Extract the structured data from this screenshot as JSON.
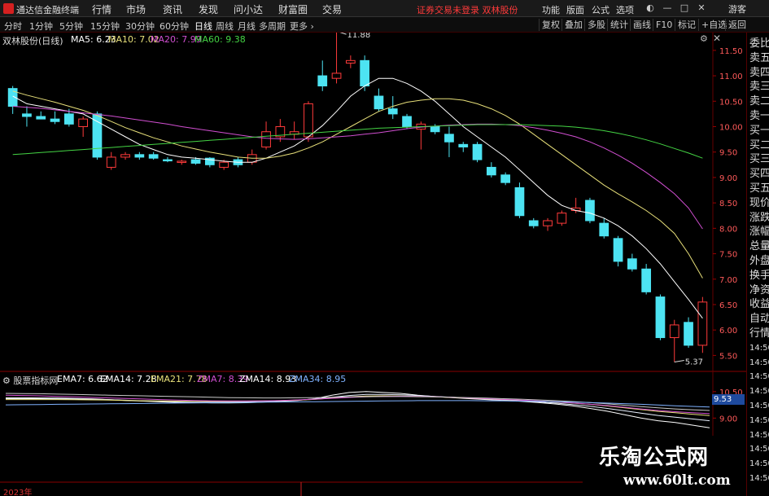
{
  "app": {
    "title": "通达信金融终端"
  },
  "menu": [
    "行情",
    "市场",
    "资讯",
    "发现",
    "问小达",
    "财富圈",
    "交易"
  ],
  "status": "证券交易未登录  双林股份",
  "topright": [
    "功能",
    "版面",
    "公式",
    "选项"
  ],
  "login": "游客",
  "periods": [
    "分时",
    "1分钟",
    "5分钟",
    "15分钟",
    "30分钟",
    "60分钟",
    "日线",
    "周线",
    "月线",
    "多周期",
    "更多"
  ],
  "periods_active": "日线",
  "toolbar_right": [
    "复权",
    "叠加",
    "多股",
    "统计",
    "画线",
    "F10",
    "标记",
    "+自选",
    "返回"
  ],
  "stock_label": "双林股份(日线)",
  "ma": {
    "ma5": {
      "label": "MA5: 6.23",
      "color": "#ffffff"
    },
    "ma10": {
      "label": "MA10: 7.02",
      "color": "#e8e07a"
    },
    "ma20": {
      "label": "MA20: 7.99",
      "color": "#d14fd1"
    },
    "ma60": {
      "label": "MA60: 9.38",
      "color": "#44d444"
    }
  },
  "high_annotation": "11.88",
  "low_annotation": "5.37",
  "right_panel": [
    "委比",
    "卖五",
    "卖四",
    "卖三",
    "卖二",
    "卖一",
    "买一",
    "买二",
    "买三",
    "买四",
    "买五",
    "现价",
    "涨跌",
    "涨幅",
    "总量",
    "外盘",
    "换手",
    "净资",
    "收益",
    "自动",
    "行情",
    "14:50",
    "14:50",
    "14:50",
    "14:50",
    "14:50",
    "14:50",
    "14:50",
    "14:50",
    "14:50",
    "14:50"
  ],
  "indicator": {
    "label": "股票指标网",
    "ema7": {
      "label": "EMA7: 6.62",
      "color": "#ffffff"
    },
    "ema14": {
      "label": "EMA14: 7.28",
      "color": "#ffffff"
    },
    "ema21": {
      "label": "EMA21: 7.78",
      "color": "#e8e07a"
    },
    "zma7": {
      "label": "ZMA7: 8.39",
      "color": "#d14fd1"
    },
    "zma14": {
      "label": "ZMA14: 8.93",
      "color": "#ffffff"
    },
    "zma34": {
      "label": "ZMA34: 8.95",
      "color": "#7fb2ff"
    },
    "tag": "9.53",
    "axis": [
      "10.50",
      "9.00"
    ]
  },
  "year_label": "2023年",
  "watermark": {
    "title": "乐淘公式网",
    "url": "www.60lt.com"
  },
  "chart_data": {
    "type": "candlestick",
    "ylim": [
      5.25,
      11.85
    ],
    "yticks": [
      "11.50",
      "11.00",
      "10.50",
      "10.00",
      "9.50",
      "9.00",
      "8.50",
      "8.00",
      "7.50",
      "7.00",
      "6.50",
      "6.00",
      "5.50"
    ],
    "colors": {
      "up": "#ff3b3b",
      "down": "#4de3f2"
    },
    "candles": [
      {
        "o": 10.75,
        "h": 10.8,
        "l": 10.25,
        "c": 10.4
      },
      {
        "o": 10.25,
        "h": 10.4,
        "l": 10.0,
        "c": 10.2
      },
      {
        "o": 10.2,
        "h": 10.3,
        "l": 10.15,
        "c": 10.15
      },
      {
        "o": 10.15,
        "h": 10.3,
        "l": 10.05,
        "c": 10.1
      },
      {
        "o": 10.25,
        "h": 10.35,
        "l": 10.0,
        "c": 10.05
      },
      {
        "o": 10.0,
        "h": 10.2,
        "l": 9.8,
        "c": 10.15
      },
      {
        "o": 10.25,
        "h": 10.3,
        "l": 9.35,
        "c": 9.4
      },
      {
        "o": 9.2,
        "h": 9.5,
        "l": 9.15,
        "c": 9.4
      },
      {
        "o": 9.4,
        "h": 9.5,
        "l": 9.35,
        "c": 9.45
      },
      {
        "o": 9.45,
        "h": 9.5,
        "l": 9.35,
        "c": 9.4
      },
      {
        "o": 9.45,
        "h": 9.5,
        "l": 9.35,
        "c": 9.38
      },
      {
        "o": 9.35,
        "h": 9.4,
        "l": 9.3,
        "c": 9.33
      },
      {
        "o": 9.3,
        "h": 9.35,
        "l": 9.25,
        "c": 9.32
      },
      {
        "o": 9.35,
        "h": 9.4,
        "l": 9.25,
        "c": 9.28
      },
      {
        "o": 9.38,
        "h": 9.4,
        "l": 9.2,
        "c": 9.25
      },
      {
        "o": 9.2,
        "h": 9.35,
        "l": 9.15,
        "c": 9.3
      },
      {
        "o": 9.35,
        "h": 9.4,
        "l": 9.2,
        "c": 9.25
      },
      {
        "o": 9.3,
        "h": 9.55,
        "l": 9.25,
        "c": 9.45
      },
      {
        "o": 9.6,
        "h": 10.1,
        "l": 9.55,
        "c": 9.9
      },
      {
        "o": 9.8,
        "h": 10.15,
        "l": 9.7,
        "c": 10.0
      },
      {
        "o": 9.85,
        "h": 10.1,
        "l": 9.75,
        "c": 9.9
      },
      {
        "o": 9.8,
        "h": 10.5,
        "l": 9.7,
        "c": 10.45
      },
      {
        "o": 11.0,
        "h": 11.3,
        "l": 10.7,
        "c": 10.8
      },
      {
        "o": 10.95,
        "h": 11.88,
        "l": 10.85,
        "c": 11.05
      },
      {
        "o": 11.25,
        "h": 11.4,
        "l": 11.15,
        "c": 11.3
      },
      {
        "o": 11.3,
        "h": 11.4,
        "l": 10.7,
        "c": 10.8
      },
      {
        "o": 10.6,
        "h": 10.75,
        "l": 10.3,
        "c": 10.35
      },
      {
        "o": 10.35,
        "h": 10.6,
        "l": 10.15,
        "c": 10.25
      },
      {
        "o": 10.2,
        "h": 10.25,
        "l": 9.95,
        "c": 10.0
      },
      {
        "o": 9.95,
        "h": 10.1,
        "l": 9.55,
        "c": 10.05
      },
      {
        "o": 10.0,
        "h": 10.05,
        "l": 9.85,
        "c": 9.9
      },
      {
        "o": 9.85,
        "h": 10.0,
        "l": 9.4,
        "c": 9.7
      },
      {
        "o": 9.65,
        "h": 9.7,
        "l": 9.5,
        "c": 9.6
      },
      {
        "o": 9.65,
        "h": 9.7,
        "l": 9.3,
        "c": 9.35
      },
      {
        "o": 9.2,
        "h": 9.3,
        "l": 9.0,
        "c": 9.05
      },
      {
        "o": 9.05,
        "h": 9.1,
        "l": 8.85,
        "c": 8.9
      },
      {
        "o": 8.8,
        "h": 8.9,
        "l": 8.2,
        "c": 8.25
      },
      {
        "o": 8.15,
        "h": 8.2,
        "l": 8.0,
        "c": 8.05
      },
      {
        "o": 8.05,
        "h": 8.2,
        "l": 7.95,
        "c": 8.15
      },
      {
        "o": 8.1,
        "h": 8.35,
        "l": 8.05,
        "c": 8.3
      },
      {
        "o": 8.35,
        "h": 8.6,
        "l": 8.3,
        "c": 8.4
      },
      {
        "o": 8.55,
        "h": 8.6,
        "l": 8.1,
        "c": 8.15
      },
      {
        "o": 8.1,
        "h": 8.2,
        "l": 7.8,
        "c": 7.85
      },
      {
        "o": 7.8,
        "h": 7.85,
        "l": 7.25,
        "c": 7.35
      },
      {
        "o": 7.4,
        "h": 7.5,
        "l": 7.15,
        "c": 7.2
      },
      {
        "o": 7.2,
        "h": 7.3,
        "l": 6.7,
        "c": 6.75
      },
      {
        "o": 6.65,
        "h": 6.7,
        "l": 5.8,
        "c": 5.85
      },
      {
        "o": 5.85,
        "h": 6.2,
        "l": 5.37,
        "c": 6.1
      },
      {
        "o": 6.15,
        "h": 6.25,
        "l": 5.65,
        "c": 5.7
      },
      {
        "o": 5.7,
        "h": 6.65,
        "l": 5.55,
        "c": 6.55
      }
    ],
    "ma_lines": {
      "ma5": [
        10.6,
        10.45,
        10.4,
        10.35,
        10.3,
        10.25,
        10.1,
        9.95,
        9.8,
        9.65,
        9.55,
        9.45,
        9.4,
        9.38,
        9.35,
        9.32,
        9.3,
        9.3,
        9.38,
        9.5,
        9.62,
        9.8,
        10.02,
        10.3,
        10.6,
        10.8,
        10.95,
        10.95,
        10.85,
        10.7,
        10.5,
        10.25,
        10.0,
        9.8,
        9.6,
        9.4,
        9.15,
        8.9,
        8.65,
        8.45,
        8.35,
        8.3,
        8.2,
        8.05,
        7.85,
        7.6,
        7.3,
        6.95,
        6.6,
        6.23
      ],
      "ma10": [
        10.7,
        10.62,
        10.55,
        10.48,
        10.4,
        10.32,
        10.22,
        10.1,
        9.98,
        9.88,
        9.78,
        9.7,
        9.62,
        9.56,
        9.5,
        9.45,
        9.4,
        9.38,
        9.38,
        9.42,
        9.48,
        9.58,
        9.7,
        9.85,
        10.0,
        10.15,
        10.3,
        10.4,
        10.48,
        10.52,
        10.55,
        10.55,
        10.52,
        10.45,
        10.35,
        10.22,
        10.05,
        9.85,
        9.65,
        9.45,
        9.25,
        9.05,
        8.85,
        8.68,
        8.52,
        8.35,
        8.15,
        7.9,
        7.5,
        7.02
      ],
      "ma20": [
        10.4,
        10.38,
        10.36,
        10.33,
        10.3,
        10.27,
        10.24,
        10.21,
        10.17,
        10.13,
        10.09,
        10.05,
        10.0,
        9.96,
        9.92,
        9.88,
        9.84,
        9.8,
        9.77,
        9.76,
        9.75,
        9.76,
        9.78,
        9.8,
        9.82,
        9.85,
        9.88,
        9.92,
        9.96,
        9.99,
        10.01,
        10.03,
        10.04,
        10.05,
        10.05,
        10.04,
        10.02,
        9.98,
        9.93,
        9.87,
        9.8,
        9.7,
        9.58,
        9.44,
        9.28,
        9.1,
        8.9,
        8.68,
        8.4,
        7.99
      ],
      "ma60": [
        9.45,
        9.47,
        9.49,
        9.51,
        9.53,
        9.55,
        9.57,
        9.59,
        9.61,
        9.63,
        9.65,
        9.67,
        9.69,
        9.71,
        9.73,
        9.75,
        9.77,
        9.79,
        9.81,
        9.83,
        9.85,
        9.87,
        9.89,
        9.91,
        9.93,
        9.95,
        9.97,
        9.98,
        9.99,
        10.0,
        10.01,
        10.02,
        10.03,
        10.04,
        10.04,
        10.04,
        10.04,
        10.03,
        10.02,
        10.01,
        9.99,
        9.96,
        9.92,
        9.87,
        9.81,
        9.74,
        9.66,
        9.57,
        9.48,
        9.38
      ]
    },
    "indicator_lines": {
      "ylim": [
        8.0,
        11.0
      ],
      "ema7": [
        10.15,
        10.15,
        10.14,
        10.13,
        10.11,
        10.09,
        10.05,
        10.0,
        9.96,
        9.92,
        9.89,
        9.87,
        9.86,
        9.86,
        9.87,
        9.9,
        9.95,
        10.0,
        10.1,
        10.3,
        10.45,
        10.5,
        10.45,
        10.4,
        10.3,
        10.22,
        10.16,
        10.1,
        10.05,
        10.0,
        9.95,
        9.88,
        9.8,
        9.7,
        9.55,
        9.4,
        9.2,
        9.0,
        8.85,
        8.75,
        8.6,
        8.45
      ],
      "ema14": [
        10.1,
        10.1,
        10.1,
        10.09,
        10.08,
        10.06,
        10.04,
        10.01,
        9.98,
        9.96,
        9.94,
        9.93,
        9.92,
        9.92,
        9.93,
        9.95,
        9.98,
        10.02,
        10.08,
        10.18,
        10.28,
        10.34,
        10.34,
        10.32,
        10.28,
        10.23,
        10.18,
        10.13,
        10.08,
        10.03,
        9.98,
        9.92,
        9.85,
        9.77,
        9.67,
        9.55,
        9.42,
        9.28,
        9.15,
        9.05,
        8.95,
        8.85
      ],
      "ema21": [
        10.05,
        10.05,
        10.05,
        10.05,
        10.04,
        10.03,
        10.02,
        10.0,
        9.98,
        9.97,
        9.96,
        9.95,
        9.95,
        9.95,
        9.96,
        9.97,
        9.99,
        10.02,
        10.06,
        10.13,
        10.2,
        10.25,
        10.26,
        10.25,
        10.23,
        10.2,
        10.17,
        10.13,
        10.09,
        10.05,
        10.01,
        9.96,
        9.91,
        9.85,
        9.78,
        9.69,
        9.59,
        9.48,
        9.38,
        9.3,
        9.22,
        9.14
      ],
      "zma7": [
        10.3,
        10.28,
        10.26,
        10.23,
        10.2,
        10.17,
        10.14,
        10.11,
        10.08,
        10.05,
        10.02,
        10.0,
        9.98,
        9.97,
        9.97,
        9.98,
        10.0,
        10.03,
        10.07,
        10.12,
        10.17,
        10.21,
        10.23,
        10.24,
        10.23,
        10.21,
        10.18,
        10.14,
        10.1,
        10.06,
        10.02,
        9.97,
        9.92,
        9.86,
        9.79,
        9.71,
        9.62,
        9.52,
        9.43,
        9.36,
        9.3,
        9.25
      ],
      "zma14": [
        10.4,
        10.39,
        10.38,
        10.36,
        10.34,
        10.32,
        10.3,
        10.28,
        10.26,
        10.24,
        10.22,
        10.2,
        10.18,
        10.16,
        10.15,
        10.14,
        10.14,
        10.15,
        10.16,
        10.18,
        10.2,
        10.21,
        10.22,
        10.22,
        10.21,
        10.2,
        10.18,
        10.16,
        10.13,
        10.1,
        10.07,
        10.03,
        9.99,
        9.94,
        9.88,
        9.81,
        9.73,
        9.65,
        9.58,
        9.52,
        9.47,
        9.43
      ],
      "zma34": [
        9.75,
        9.76,
        9.77,
        9.78,
        9.79,
        9.8,
        9.81,
        9.82,
        9.83,
        9.84,
        9.85,
        9.86,
        9.87,
        9.88,
        9.89,
        9.9,
        9.91,
        9.92,
        9.93,
        9.94,
        9.95,
        9.96,
        9.97,
        9.98,
        9.99,
        9.99,
        9.99,
        9.99,
        9.98,
        9.97,
        9.96,
        9.95,
        9.93,
        9.91,
        9.88,
        9.85,
        9.82,
        9.78,
        9.74,
        9.7,
        9.66,
        9.63
      ]
    }
  }
}
